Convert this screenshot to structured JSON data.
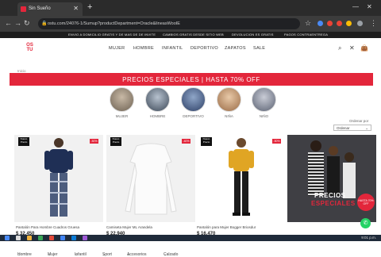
{
  "browser": {
    "tab_title": "Sin Sueño",
    "url": "ostu.com/24076-1/Sumup?productDepartment=Oracle&lineasWooIE"
  },
  "promo_bar": [
    "ENVIO A DOMICILIO GRATIS Y DE MAS DE DE INVITE",
    "CAMBIOS GRATIS DESDE SITIO WEB",
    "DEVOLUCION ES GRATIS",
    "PAGOS CONTRAENTREGA"
  ],
  "header": {
    "logo_text": "OS TU",
    "nav": [
      "MUJER",
      "HOMBRE",
      "INFANTIL",
      "DEPORTIVO",
      "ZAPATOS",
      "SALE"
    ]
  },
  "breadcrumb": "Inicio",
  "banner": "PRECIOS ESPECIALES | HASTA 70% OFF",
  "categories": [
    "MUJER",
    "HOMBRE",
    "DEPORTIVO",
    "NIÑA",
    "NIÑO"
  ],
  "filters": [
    "Hombre",
    "Mujer",
    "Infantil",
    "Sport",
    "Accesorios",
    "Calzado"
  ],
  "order": {
    "label": "Ordenar por",
    "value": "Ordenar"
  },
  "products": [
    {
      "name": "Pantalón Para Hombre Cuadros Gruesa",
      "price": "$ 32.450",
      "badge_new": "Nuevo Precio",
      "badge_sale": "-50%"
    },
    {
      "name": "Camiseta Mujer ML Arandela",
      "price": "$ 22.940",
      "badge_new": "Nuevo Precio",
      "badge_sale": "-40%"
    },
    {
      "name": "Pantalón para Mujer Bogger Briosdur",
      "price": "$ 16.470",
      "badge_new": "Nuevo Precio",
      "badge_sale": "-50%"
    }
  ],
  "promo_tile": {
    "line1": "PRECIOS",
    "line2": "ESPECIALES",
    "badge": "HASTA 70% OFF"
  },
  "taskbar": {
    "time": "9:01 p.m."
  },
  "colors": {
    "accent": "#e3263b",
    "dark": "#1d1d1d",
    "whatsapp": "#25d366"
  }
}
